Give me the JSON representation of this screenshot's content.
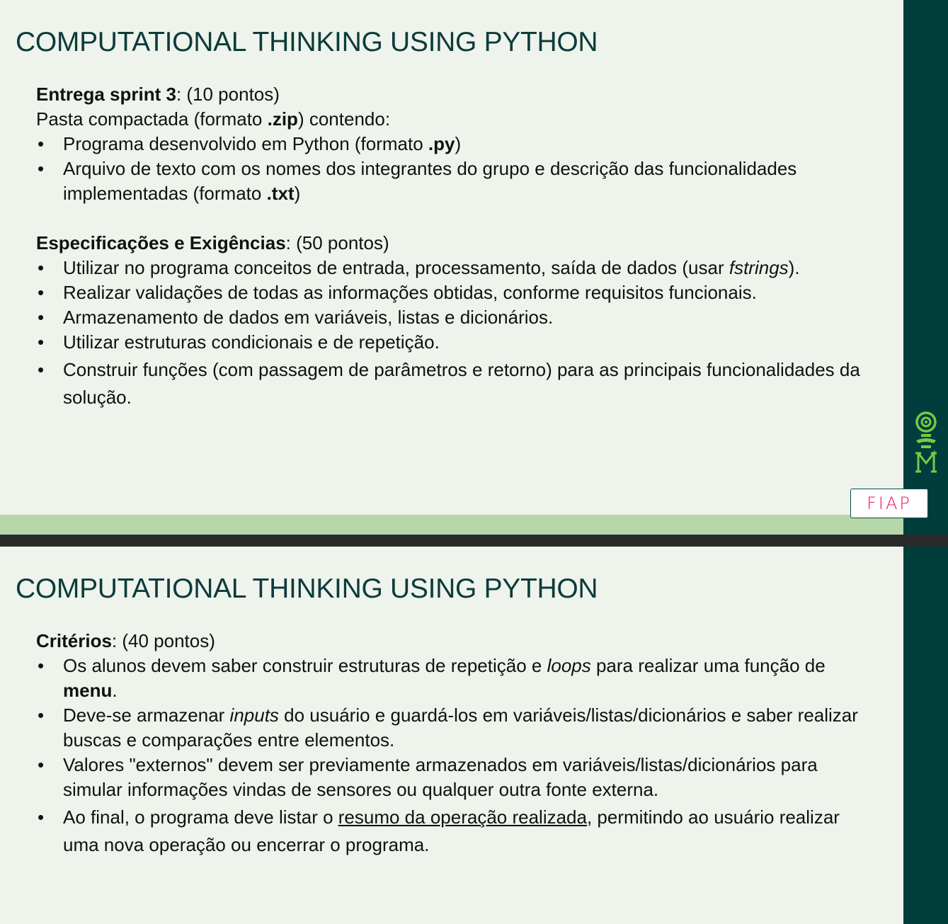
{
  "slide1": {
    "title": "COMPUTATIONAL THINKING USING PYTHON",
    "delivery": {
      "heading": "Entrega sprint 3",
      "points": ": (10 pontos)",
      "intro_prefix": "Pasta compactada (formato ",
      "intro_bold": ".zip",
      "intro_suffix": ") contendo:",
      "items": [
        {
          "prefix": "Programa desenvolvido em Python (formato ",
          "bold": ".py",
          "suffix": ")"
        },
        {
          "prefix": "Arquivo de texto com os nomes dos integrantes do grupo e descrição das funcionalidades implementadas (formato ",
          "bold": ".txt",
          "suffix": ")"
        }
      ]
    },
    "specs": {
      "heading": "Especificações e Exigências",
      "points": ": (50 pontos)",
      "item1_text": "Utilizar no programa conceitos de entrada, processamento, saída de dados (usar ",
      "item1_italic": "fstrings",
      "item1_suffix": ").",
      "item2": "Realizar validações de todas as informações obtidas, conforme requisitos funcionais.",
      "item3": "Armazenamento de dados em variáveis, listas e dicionários.",
      "item4": "Utilizar estruturas condicionais e de repetição.",
      "item5": "Construir funções (com passagem de parâmetros e retorno) para as principais funcionalidades da solução."
    },
    "logo_text": "FIAP",
    "colors": {
      "background": "#eef3ec",
      "sidebar": "#003d3d",
      "title": "#0c3b3b",
      "green_band": "#b7d7a8",
      "logo_pink": "#ed145b",
      "mascot_green": "#7ac943"
    }
  },
  "slide2": {
    "title": "COMPUTATIONAL THINKING USING PYTHON",
    "criteria": {
      "heading": "Critérios",
      "points": ": (40 pontos)",
      "item1_prefix": "Os alunos devem saber construir estruturas de repetição e ",
      "item1_italic": "loops",
      "item1_mid": " para realizar uma função de ",
      "item1_bold": "menu",
      "item1_suffix": ".",
      "item2_prefix": "Deve-se armazenar ",
      "item2_italic": "inputs",
      "item2_suffix": " do usuário e guardá-los em variáveis/listas/dicionários e saber realizar buscas e comparações entre elementos.",
      "item3": "Valores \"externos\" devem ser previamente armazenados em variáveis/listas/dicionários para simular informações vindas de sensores ou qualquer outra fonte externa.",
      "item4_prefix": "Ao final, o programa deve listar o ",
      "item4_underline": "resumo da operação realizada",
      "item4_suffix": ", permitindo ao usuário realizar uma nova operação ou encerrar o programa."
    }
  }
}
